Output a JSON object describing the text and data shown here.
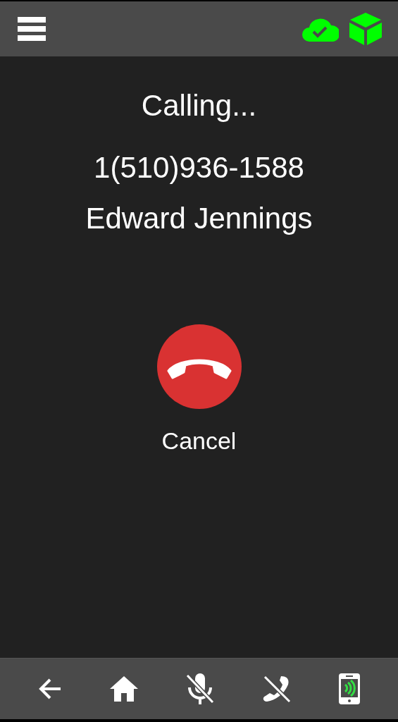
{
  "call": {
    "status": "Calling...",
    "number": "1(510)936-1588",
    "name": "Edward Jennings"
  },
  "cancel": {
    "label": "Cancel"
  }
}
